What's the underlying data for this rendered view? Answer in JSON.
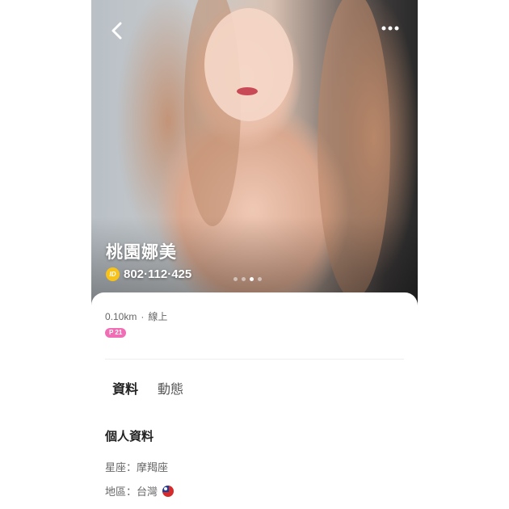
{
  "profile": {
    "name": "桃園娜美",
    "id_badge": "ID",
    "id_number": "802·112·425",
    "photo_index": 3,
    "photo_count": 4
  },
  "meta": {
    "distance": "0.10km",
    "separator": "·",
    "status": "線上",
    "level_badge": "P 21"
  },
  "tabs": [
    {
      "label": "資料",
      "active": true
    },
    {
      "label": "動態",
      "active": false
    }
  ],
  "personal_info": {
    "title": "個人資料",
    "zodiac": "星座：摩羯座",
    "region": "地區：台灣"
  },
  "colors": {
    "accent": "#f7c21a",
    "level_badge": "#f06fb4"
  },
  "icons": {
    "back": "chevron-left-icon",
    "more": "more-dots-icon",
    "flag": "taiwan-flag-icon"
  }
}
